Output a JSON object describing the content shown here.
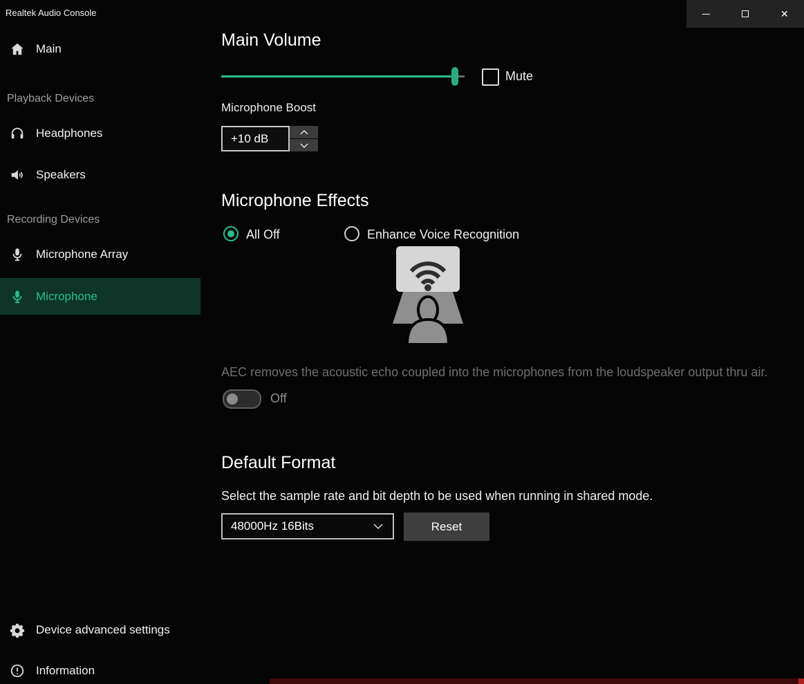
{
  "window": {
    "title": "Realtek Audio Console",
    "close_glyph": "✕"
  },
  "sidebar": {
    "main": "Main",
    "playback_header": "Playback Devices",
    "headphones": "Headphones",
    "speakers": "Speakers",
    "recording_header": "Recording Devices",
    "microphone_array": "Microphone Array",
    "microphone": "Microphone",
    "device_advanced_settings": "Device advanced settings",
    "information": "Information"
  },
  "main_volume": {
    "title": "Main Volume",
    "mute_label": "Mute",
    "value_pct": 96,
    "muted": false
  },
  "mic_boost": {
    "label": "Microphone Boost",
    "value": "+10 dB"
  },
  "mic_effects": {
    "title": "Microphone Effects",
    "option_all_off": "All Off",
    "option_enhance": "Enhance Voice Recognition",
    "selected_option": "All Off",
    "aec_description": "AEC removes the acoustic echo coupled into the microphones from the loudspeaker output thru air.",
    "aec_toggle_state": "Off"
  },
  "default_format": {
    "title": "Default Format",
    "description": "Select the sample rate and bit depth to be used when running in shared mode.",
    "selected_value": "48000Hz 16Bits",
    "reset_label": "Reset"
  },
  "colors": {
    "accent": "#2dbd91",
    "selected_item_bg": "#0e3528"
  }
}
